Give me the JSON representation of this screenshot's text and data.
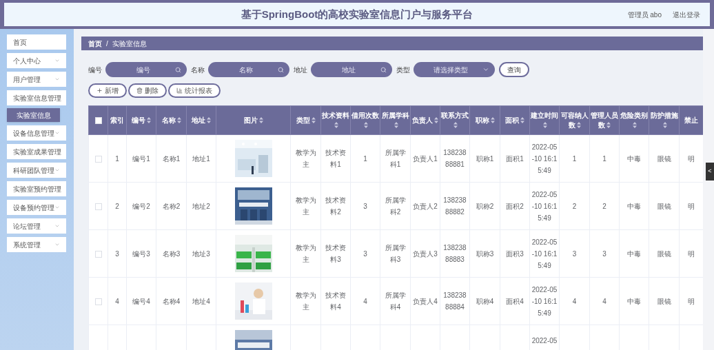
{
  "header": {
    "title": "基于SpringBoot的高校实验室信息门户与服务平台",
    "user": "管理员 abo",
    "logout": "退出登录"
  },
  "sidebar": {
    "items": [
      {
        "label": "首页",
        "kind": "link"
      },
      {
        "label": "个人中心",
        "kind": "submenu"
      },
      {
        "label": "用户管理",
        "kind": "submenu"
      },
      {
        "label": "实验室信息管理",
        "kind": "submenu",
        "children": [
          {
            "label": "实验室信息",
            "selected": true
          }
        ]
      },
      {
        "label": "设备信息管理",
        "kind": "submenu"
      },
      {
        "label": "实验室成果管理",
        "kind": "submenu"
      },
      {
        "label": "科研团队管理",
        "kind": "submenu"
      },
      {
        "label": "实验室预约管理",
        "kind": "submenu"
      },
      {
        "label": "设备预约管理",
        "kind": "submenu"
      },
      {
        "label": "论坛管理",
        "kind": "submenu"
      },
      {
        "label": "系统管理",
        "kind": "submenu"
      }
    ]
  },
  "breadcrumb": [
    "首页",
    "实验室信息"
  ],
  "breadcrumb_separator": "/",
  "search": {
    "fields": [
      {
        "label": "编号",
        "placeholder": "编号",
        "kind": "input"
      },
      {
        "label": "名称",
        "placeholder": "名称",
        "kind": "input"
      },
      {
        "label": "地址",
        "placeholder": "地址",
        "kind": "input"
      },
      {
        "label": "类型",
        "placeholder": "请选择类型",
        "kind": "select"
      }
    ],
    "button": "查询"
  },
  "actions": [
    {
      "label": "新增",
      "kind": "add"
    },
    {
      "label": "删除",
      "kind": "delete"
    },
    {
      "label": "统计报表",
      "kind": "chart"
    }
  ],
  "table": {
    "header_checked": false,
    "columns": [
      {
        "label": "索引",
        "sortable": false,
        "kind": "text"
      },
      {
        "label": "编号",
        "sortable": true,
        "kind": "text"
      },
      {
        "label": "名称",
        "sortable": true,
        "kind": "text"
      },
      {
        "label": "地址",
        "sortable": true,
        "kind": "text"
      },
      {
        "label": "图片",
        "sortable": true,
        "kind": "picture"
      },
      {
        "label": "类型",
        "sortable": true,
        "kind": "text"
      },
      {
        "label": "技术资料",
        "sortable": true,
        "kind": "text"
      },
      {
        "label": "借用次数",
        "sortable": true,
        "kind": "text"
      },
      {
        "label": "所属学科",
        "sortable": true,
        "kind": "text"
      },
      {
        "label": "负责人",
        "sortable": true,
        "kind": "text"
      },
      {
        "label": "联系方式",
        "sortable": true,
        "kind": "text"
      },
      {
        "label": "职称",
        "sortable": true,
        "kind": "text"
      },
      {
        "label": "面积",
        "sortable": true,
        "kind": "text"
      },
      {
        "label": "建立时间",
        "sortable": true,
        "kind": "text"
      },
      {
        "label": "可容纳人数",
        "sortable": true,
        "kind": "text"
      },
      {
        "label": "管理人员数",
        "sortable": true,
        "kind": "text"
      },
      {
        "label": "危险类别",
        "sortable": true,
        "kind": "text"
      },
      {
        "label": "防护措施",
        "sortable": true,
        "kind": "text"
      },
      {
        "label": "禁止",
        "sortable": false,
        "kind": "text"
      }
    ],
    "rows": [
      {
        "checked": false,
        "cells": [
          "1",
          "编号1",
          "名称1",
          "地址1",
          {
            "kind": "picture"
          },
          "教学为主",
          "技术资料1",
          "1",
          "所属学科1",
          "负责人1",
          "13823888881",
          "职称1",
          "面积1",
          "2022-05-10 16:15:49",
          "1",
          "1",
          "中毒",
          "眼镜",
          "明"
        ]
      },
      {
        "checked": false,
        "cells": [
          "2",
          "编号2",
          "名称2",
          "地址2",
          {
            "kind": "picture"
          },
          "教学为主",
          "技术资料2",
          "3",
          "所属学科2",
          "负责人2",
          "13823888882",
          "职称2",
          "面积2",
          "2022-05-10 16:15:49",
          "2",
          "2",
          "中毒",
          "眼镜",
          "明"
        ]
      },
      {
        "checked": false,
        "cells": [
          "3",
          "编号3",
          "名称3",
          "地址3",
          {
            "kind": "picture"
          },
          "教学为主",
          "技术资料3",
          "3",
          "所属学科3",
          "负责人3",
          "13823888883",
          "职称3",
          "面积3",
          "2022-05-10 16:15:49",
          "3",
          "3",
          "中毒",
          "眼镜",
          "明"
        ]
      },
      {
        "checked": false,
        "cells": [
          "4",
          "编号4",
          "名称4",
          "地址4",
          {
            "kind": "picture"
          },
          "教学为主",
          "技术资料4",
          "4",
          "所属学科4",
          "负责人4",
          "13823888884",
          "职称4",
          "面积4",
          "2022-05-10 16:15:49",
          "4",
          "4",
          "中毒",
          "眼镜",
          "明"
        ]
      }
    ],
    "cut_row": {
      "time": "2022-05"
    }
  },
  "side_tab": "<"
}
